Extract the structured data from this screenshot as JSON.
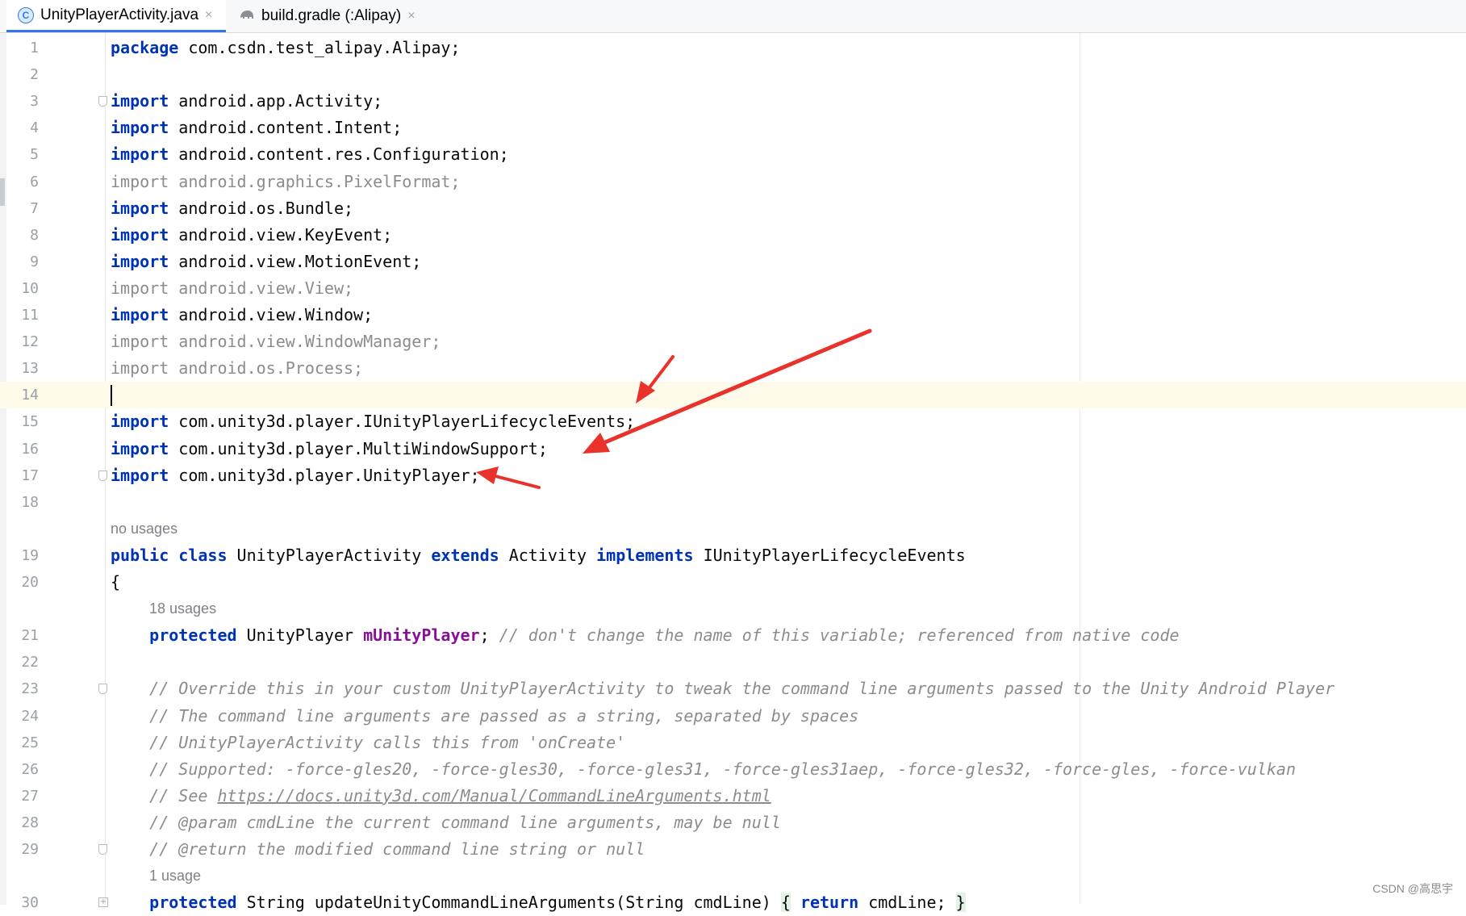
{
  "tabs": [
    {
      "icon": "java-class-icon",
      "icon_glyph": "C",
      "label": "UnityPlayerActivity.java",
      "active": true
    },
    {
      "icon": "gradle-elephant-icon",
      "label": "build.gradle (:Alipay)",
      "active": false
    }
  ],
  "tab_close_glyph": "×",
  "editor": {
    "current_line": 14,
    "lines": [
      {
        "n": "1",
        "segs": [
          [
            "kw",
            "package"
          ],
          [
            "",
            "com.csdn.test_alipay.Alipay;"
          ]
        ]
      },
      {
        "n": "2",
        "segs": []
      },
      {
        "n": "3",
        "fold": true,
        "segs": [
          [
            "kw",
            "import"
          ],
          [
            "",
            "android.app.Activity;"
          ]
        ]
      },
      {
        "n": "4",
        "segs": [
          [
            "kw",
            "import"
          ],
          [
            "",
            "android.content.Intent;"
          ]
        ]
      },
      {
        "n": "5",
        "segs": [
          [
            "kw",
            "import"
          ],
          [
            "",
            "android.content.res.Configuration;"
          ]
        ]
      },
      {
        "n": "6",
        "segs": [
          [
            "dim",
            "import android.graphics.PixelFormat;"
          ]
        ]
      },
      {
        "n": "7",
        "segs": [
          [
            "kw",
            "import"
          ],
          [
            "",
            "android.os.Bundle;"
          ]
        ]
      },
      {
        "n": "8",
        "segs": [
          [
            "kw",
            "import"
          ],
          [
            "",
            "android.view.KeyEvent;"
          ]
        ]
      },
      {
        "n": "9",
        "segs": [
          [
            "kw",
            "import"
          ],
          [
            "",
            "android.view.MotionEvent;"
          ]
        ]
      },
      {
        "n": "10",
        "segs": [
          [
            "dim",
            "import android.view.View;"
          ]
        ]
      },
      {
        "n": "11",
        "segs": [
          [
            "kw",
            "import"
          ],
          [
            "",
            "android.view.Window;"
          ]
        ]
      },
      {
        "n": "12",
        "segs": [
          [
            "dim",
            "import android.view.WindowManager;"
          ]
        ]
      },
      {
        "n": "13",
        "segs": [
          [
            "dim",
            "import android.os.Process;"
          ]
        ]
      },
      {
        "n": "14",
        "caret": true,
        "segs": []
      },
      {
        "n": "15",
        "segs": [
          [
            "kw",
            "import"
          ],
          [
            "",
            "com.unity3d.player.IUnityPlayerLifecycleEvents;"
          ]
        ]
      },
      {
        "n": "16",
        "segs": [
          [
            "kw",
            "import"
          ],
          [
            "",
            "com.unity3d.player.MultiWindowSupport;"
          ]
        ]
      },
      {
        "n": "17",
        "fold": true,
        "segs": [
          [
            "kw",
            "import"
          ],
          [
            "",
            "com.unity3d.player.UnityPlayer;"
          ]
        ]
      },
      {
        "n": "18",
        "segs": []
      },
      {
        "hint": "no usages",
        "indent": 0
      },
      {
        "n": "19",
        "segs": [
          [
            "kw",
            "public"
          ],
          [
            "",
            "  "
          ],
          [
            "kw",
            "class"
          ],
          [
            "",
            " UnityPlayerActivity "
          ],
          [
            "kw",
            "extends"
          ],
          [
            "",
            " Activity "
          ],
          [
            "kw",
            "implements"
          ],
          [
            "",
            " IUnityPlayerLifecycleEvents"
          ]
        ]
      },
      {
        "n": "20",
        "segs": [
          [
            "",
            "{"
          ]
        ]
      },
      {
        "hint": "18 usages",
        "indent": 1
      },
      {
        "n": "21",
        "segs": [
          [
            "",
            "    "
          ],
          [
            "kw",
            "protected"
          ],
          [
            "",
            " UnityPlayer "
          ],
          [
            "fld",
            "mUnityPlayer"
          ],
          [
            "",
            ";"
          ],
          [
            "cm",
            " // don't change the name of this variable; referenced from native code"
          ]
        ]
      },
      {
        "n": "22",
        "segs": []
      },
      {
        "n": "23",
        "fold": true,
        "segs": [
          [
            "cm",
            "    // Override this in your custom UnityPlayerActivity to tweak the command line arguments passed to the Unity Android Player"
          ]
        ]
      },
      {
        "n": "24",
        "segs": [
          [
            "cm",
            "    // The command line arguments are passed as a string, separated by spaces"
          ]
        ]
      },
      {
        "n": "25",
        "segs": [
          [
            "cm",
            "    // UnityPlayerActivity calls this from 'onCreate'"
          ]
        ]
      },
      {
        "n": "26",
        "segs": [
          [
            "cm",
            "    // Supported: -force-gles20, -force-gles30, -force-gles31, -force-gles31aep, -force-gles32, -force-gles, -force-vulkan"
          ]
        ]
      },
      {
        "n": "27",
        "segs": [
          [
            "cm",
            "    // See "
          ],
          [
            "lnk",
            "https://docs.unity3d.com/Manual/CommandLineArguments.html"
          ]
        ]
      },
      {
        "n": "28",
        "segs": [
          [
            "cm",
            "    // @param cmdLine the current command line arguments, may be null"
          ]
        ]
      },
      {
        "n": "29",
        "fold": true,
        "segs": [
          [
            "cm",
            "    // @return the modified command line string or null"
          ]
        ]
      },
      {
        "hint": "1 usage",
        "indent": 1
      },
      {
        "n": "30",
        "foldplus": true,
        "segs": [
          [
            "",
            "    "
          ],
          [
            "kw",
            "protected"
          ],
          [
            "",
            " String updateUnityCommandLineArguments(String cmdLine) "
          ],
          [
            "brk",
            "{"
          ],
          [
            "",
            " "
          ],
          [
            "kw",
            "return"
          ],
          [
            "",
            " cmdLine; "
          ],
          [
            "brk",
            "}"
          ]
        ]
      }
    ]
  },
  "watermark": "CSDN @高思宇",
  "annotation_color": "#e8322b"
}
